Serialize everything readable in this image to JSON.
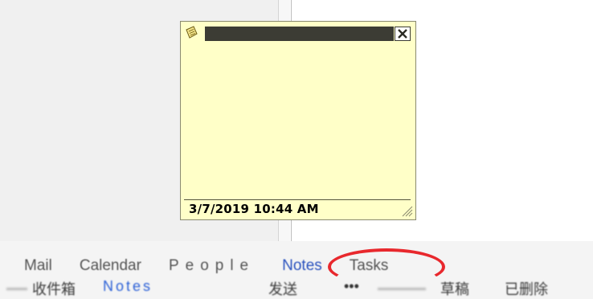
{
  "note": {
    "timestamp": "3/7/2019 10:44 AM",
    "title_bar_color": "#3c3c34",
    "background_color": "#ffffc8",
    "icons": [
      "note-pad-icon",
      "close-icon",
      "resize-grip-icon"
    ]
  },
  "navigation": {
    "items": [
      {
        "label": "Mail"
      },
      {
        "label": "Calendar"
      },
      {
        "label": "People"
      },
      {
        "label": "Notes"
      },
      {
        "label": "Tasks"
      }
    ],
    "active_label": "Notes",
    "highlight_color": "#e8282d"
  },
  "taskbar": {
    "items": [
      {
        "label": "收件箱"
      },
      {
        "label": "Notes"
      },
      {
        "label": "发送"
      },
      {
        "label": "草稿"
      },
      {
        "label": "已删除"
      }
    ],
    "overflow_label": "•••"
  }
}
